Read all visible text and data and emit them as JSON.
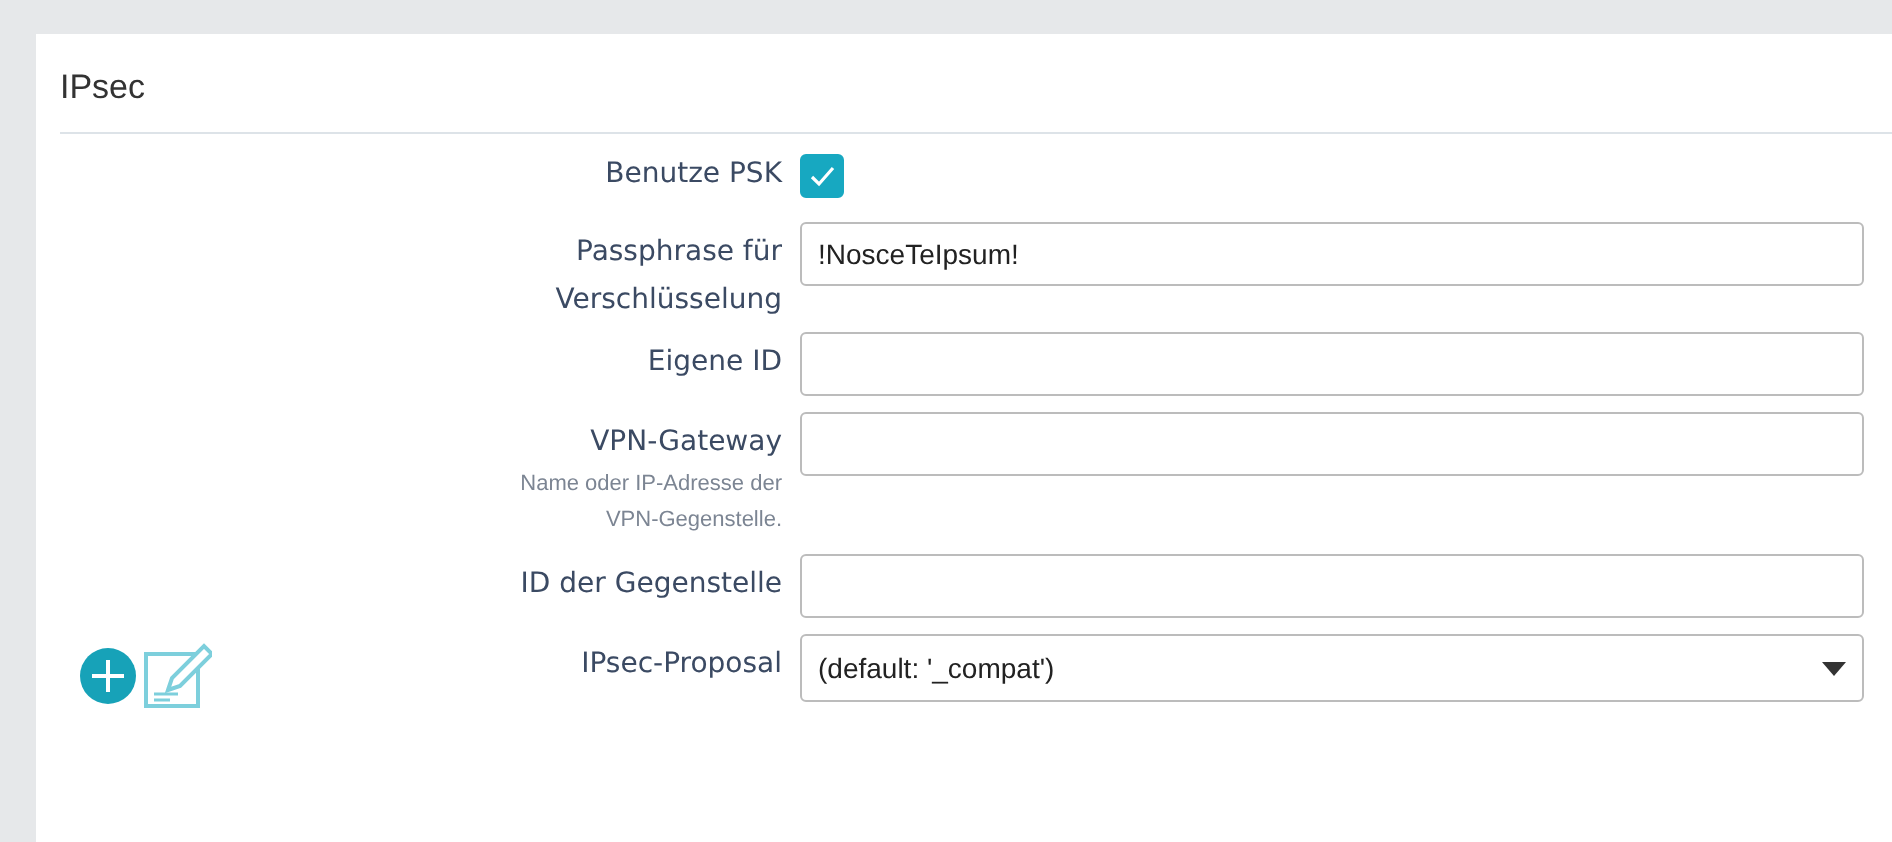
{
  "section": {
    "title": "IPsec"
  },
  "fields": [
    {
      "kind": "checkbox",
      "label": "Benutze PSK",
      "checked": true
    },
    {
      "kind": "text",
      "label": "Passphrase für Verschlüsselung",
      "value": "!NosceTeIpsum!"
    },
    {
      "kind": "text",
      "label": "Eigene ID"
    },
    {
      "kind": "text",
      "label": "VPN-Gateway",
      "hint": "Name oder IP-Adresse der VPN-Gegenstelle."
    },
    {
      "kind": "text",
      "label": "ID der Gegenstelle"
    },
    {
      "kind": "select",
      "label": "IPsec-Proposal",
      "value": "(default: '_compat')"
    }
  ]
}
